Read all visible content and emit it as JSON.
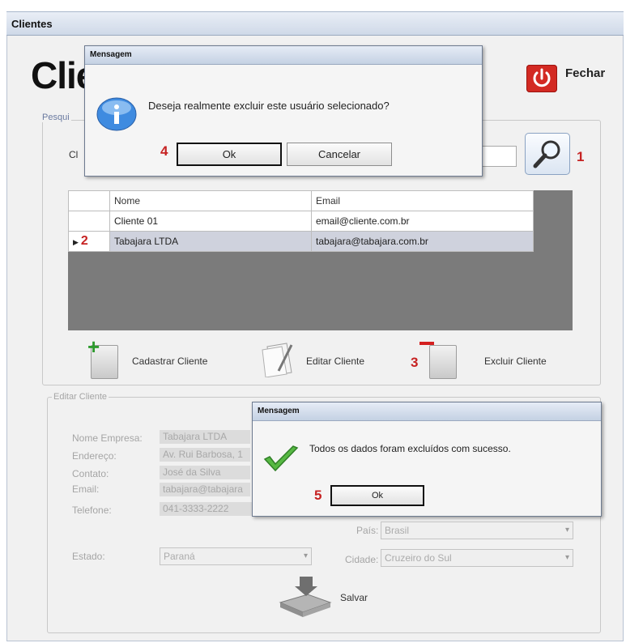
{
  "window": {
    "title": "Clientes"
  },
  "header": {
    "title": "Clie",
    "close_label": "Fechar"
  },
  "search": {
    "legend": "Pesqui",
    "field_label": "Cl",
    "step": "1"
  },
  "grid": {
    "columns": [
      "Nome",
      "Email"
    ],
    "rows": [
      {
        "name": "Cliente 01",
        "email": "email@cliente.com.br",
        "selected": false
      },
      {
        "name": "Tabajara LTDA",
        "email": "tabajara@tabajara.com.br",
        "selected": true
      }
    ],
    "row_marker": "▶",
    "step": "2"
  },
  "toolbar": {
    "add_label": "Cadastrar Cliente",
    "edit_label": "Editar Cliente",
    "delete_label": "Excluir Cliente",
    "delete_step": "3"
  },
  "edit": {
    "legend": "Editar Cliente",
    "company_label": "Nome Empresa:",
    "company_value": "Tabajara LTDA",
    "address_label": "Endereço:",
    "address_value": "Av. Rui Barbosa, 1",
    "contact_label": "Contato:",
    "contact_value": "José da Silva",
    "email_label": "Email:",
    "email_value": "tabajara@tabajara",
    "phone_label": "Telefone:",
    "phone_value": "041-3333-2222",
    "state_label": "Estado:",
    "state_value": "Paraná",
    "country_label": "País:",
    "country_value": "Brasil",
    "city_label": "Cidade:",
    "city_value": "Cruzeiro do Sul",
    "save_label": "Salvar"
  },
  "confirm_dialog": {
    "title": "Mensagem",
    "message": "Deseja realmente excluir este usuário selecionado?",
    "ok_label": "Ok",
    "cancel_label": "Cancelar",
    "step": "4"
  },
  "success_dialog": {
    "title": "Mensagem",
    "message": "Todos os dados foram excluídos com sucesso.",
    "ok_label": "Ok",
    "step": "5"
  },
  "colors": {
    "accent": "#c62222",
    "close": "#d32a23",
    "title_bar": "#cfd9e8"
  }
}
